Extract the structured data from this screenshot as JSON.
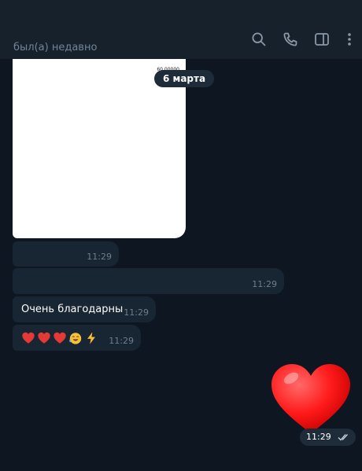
{
  "header": {
    "status": "был(а) недавно",
    "icons": [
      "search-icon",
      "phone-icon",
      "sidebar-toggle-icon",
      "more-vertical-icon"
    ]
  },
  "chat": {
    "date_divider": "6 марта",
    "photo": {
      "snippet": "60.00000"
    },
    "messages": [
      {
        "text": "",
        "time": "11:29"
      },
      {
        "text": "",
        "time": "11:29"
      },
      {
        "text": "Очень благодарны",
        "time": "11:29"
      },
      {
        "emojis": [
          "red-heart",
          "red-heart",
          "red-heart",
          "laughing-face",
          "lightning"
        ],
        "time": "11:29"
      }
    ],
    "sticker": {
      "icon": "big-red-heart-sticker",
      "time": "11:29",
      "read": true
    }
  },
  "colors": {
    "background": "#0e1621",
    "header": "#17212b",
    "incoming_bubble": "#182533",
    "secondary_text": "#708499",
    "heart": "#ff1a1a"
  }
}
